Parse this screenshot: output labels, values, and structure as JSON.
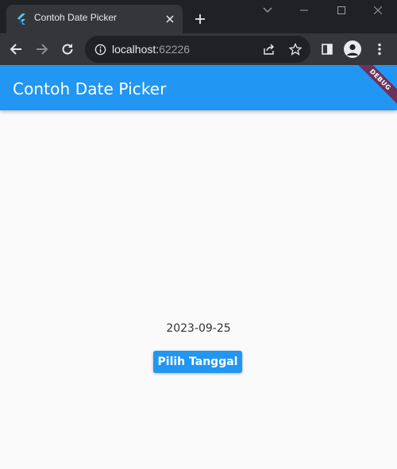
{
  "browser": {
    "tab": {
      "title": "Contoh Date Picker",
      "favicon": "flutter-icon"
    },
    "toolbar": {
      "url_host": "localhost:",
      "url_port": "62226"
    },
    "colors": {
      "frame": "#202124",
      "toolbar": "#35363a",
      "omnibox": "#202124",
      "text": "#e8eaed",
      "muted": "#9aa0a6"
    }
  },
  "app": {
    "title": "Contoh Date Picker",
    "debug_banner": "DEBUG",
    "selected_date": "2023-09-25",
    "button_label": "Pilih Tanggal",
    "colors": {
      "primary": "#2196f3",
      "background": "#fafafa",
      "debug_banner": "#7a2140"
    }
  }
}
